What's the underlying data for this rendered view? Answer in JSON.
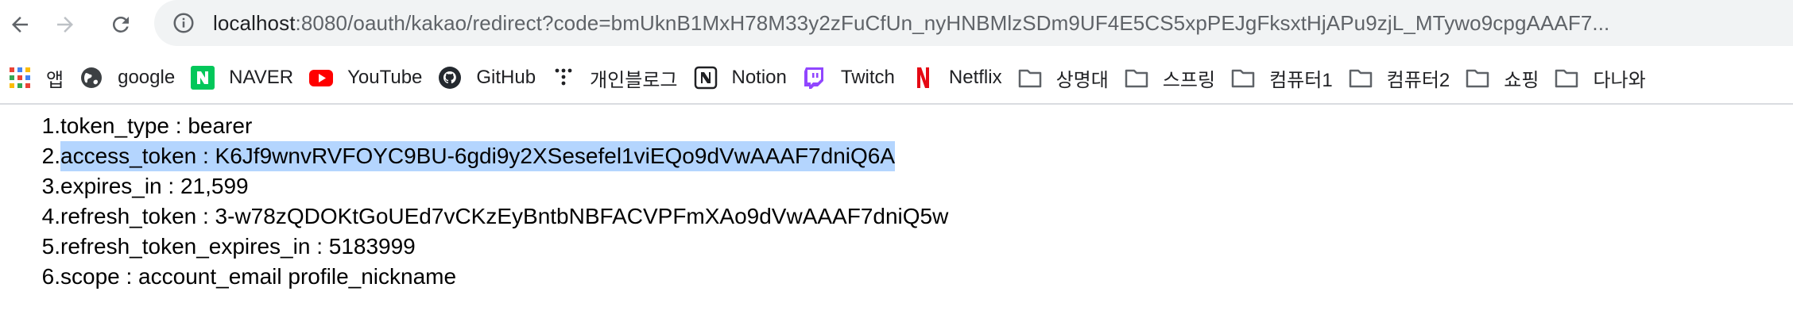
{
  "browser": {
    "url_host": "localhost",
    "url_rest": ":8080/oauth/kakao/redirect?code=bmUknB1MxH78M33y2zFuCfUn_nyHNBMlzSDm9UF4E5CS5xpPEJgFksxtHjAPu9zjL_MTywo9cpgAAAF7..."
  },
  "bookmarks": [
    {
      "label": "앱",
      "icon": "apps-grid-icon"
    },
    {
      "label": "google",
      "icon": "globe-icon"
    },
    {
      "label": "NAVER",
      "icon": "naver-icon"
    },
    {
      "label": "YouTube",
      "icon": "youtube-icon"
    },
    {
      "label": "GitHub",
      "icon": "github-icon"
    },
    {
      "label": "개인블로그",
      "icon": "dots-icon"
    },
    {
      "label": "Notion",
      "icon": "notion-icon"
    },
    {
      "label": "Twitch",
      "icon": "twitch-icon"
    },
    {
      "label": "Netflix",
      "icon": "netflix-icon"
    },
    {
      "label": "상명대",
      "icon": "folder-icon"
    },
    {
      "label": "스프링",
      "icon": "folder-icon"
    },
    {
      "label": "컴퓨터1",
      "icon": "folder-icon"
    },
    {
      "label": "컴퓨터2",
      "icon": "folder-icon"
    },
    {
      "label": "쇼핑",
      "icon": "folder-icon"
    },
    {
      "label": "다나와",
      "icon": "folder-icon"
    }
  ],
  "colors": {
    "selection": "#b4d5fe",
    "omnibox_bg": "#f1f3f4",
    "naver": "#03c75a",
    "youtube": "#ff0000",
    "twitch": "#9146ff",
    "netflix": "#e50914"
  },
  "tokens": [
    {
      "num": "1.",
      "text": "token_type : bearer",
      "selected": false
    },
    {
      "num": "2.",
      "text": "access_token : K6Jf9wnvRVFOYC9BU-6gdi9y2XSesefel1viEQo9dVwAAAF7dniQ6A",
      "selected": true
    },
    {
      "num": "3.",
      "text": "expires_in : 21,599",
      "selected": false
    },
    {
      "num": "4.",
      "text": "refresh_token : 3-w78zQDOKtGoUEd7vCKzEyBntbNBFACVPFmXAo9dVwAAAF7dniQ5w",
      "selected": false
    },
    {
      "num": "5.",
      "text": "refresh_token_expires_in : 5183999",
      "selected": false
    },
    {
      "num": "6.",
      "text": "scope : account_email profile_nickname",
      "selected": false
    }
  ]
}
